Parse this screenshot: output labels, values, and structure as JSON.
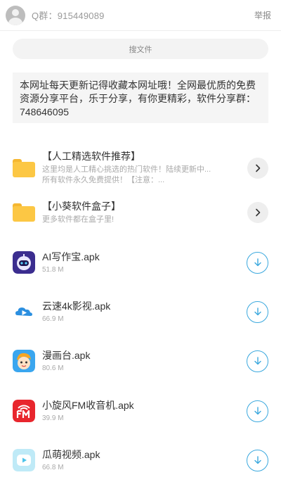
{
  "header": {
    "qq_group": "Q群：915449089",
    "report_label": "举报"
  },
  "search": {
    "label": "搜文件"
  },
  "notice": {
    "text": "本网址每天更新记得收藏本网址哦！全网最优质的免费资源分享平台，乐于分享，有你更精彩，软件分享群：748646095"
  },
  "folders": [
    {
      "title": "【人工精选软件推荐】",
      "desc": "这里均是人工精心挑选的热门软件！陆续更新中...所有软件永久免费提供！【注意：..."
    },
    {
      "title": "【小葵软件盒子】",
      "desc": "更多软件都在盒子里!"
    }
  ],
  "files": [
    {
      "name": "AI写作宝.apk",
      "size": "51.8 M",
      "icon": "robot-icon"
    },
    {
      "name": "云速4k影视.apk",
      "size": "66.9 M",
      "icon": "cloud-play-icon"
    },
    {
      "name": "漫画台.apk",
      "size": "80.6 M",
      "icon": "comic-face-icon"
    },
    {
      "name": "小旋风FM收音机.apk",
      "size": "39.9 M",
      "icon": "fm-radio-icon"
    },
    {
      "name": "瓜萌视频.apk",
      "size": "66.8 M",
      "icon": "video-play-icon"
    }
  ],
  "colors": {
    "accent": "#3aa8de",
    "folder": "#fcc744",
    "fm_red": "#e8262d"
  }
}
